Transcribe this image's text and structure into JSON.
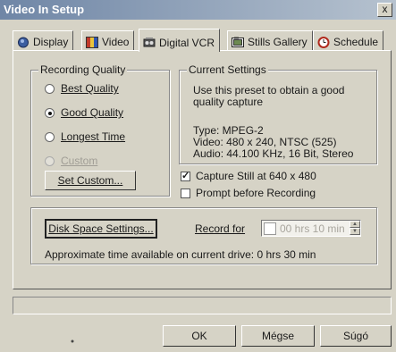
{
  "window": {
    "title": "Video In Setup",
    "close_glyph": "x"
  },
  "tabs": [
    {
      "label": "Display",
      "icon": "display-icon",
      "selected": false
    },
    {
      "label": "Video",
      "icon": "video-icon",
      "selected": false
    },
    {
      "label": "Digital VCR",
      "icon": "digital-vcr-icon",
      "selected": true
    },
    {
      "label": "Stills Gallery",
      "icon": "stills-gallery-icon",
      "selected": false
    },
    {
      "label": "Schedule",
      "icon": "schedule-icon",
      "selected": false
    }
  ],
  "recording_quality": {
    "title": "Recording Quality",
    "options": [
      {
        "label": "Best Quality",
        "selected": false,
        "enabled": true
      },
      {
        "label": "Good Quality",
        "selected": true,
        "enabled": true
      },
      {
        "label": "Longest Time",
        "selected": false,
        "enabled": true
      },
      {
        "label": "Custom",
        "selected": false,
        "enabled": false
      }
    ],
    "set_custom_label": "Set Custom..."
  },
  "current_settings": {
    "title": "Current Settings",
    "description_line1": "Use this preset to obtain a good",
    "description_line2": "quality capture",
    "type_line": "Type:  MPEG-2",
    "video_line": "Video:  480 x 240, NTSC (525)",
    "audio_line": "Audio:  44.100 KHz, 16 Bit, Stereo"
  },
  "options": {
    "capture_still_label": "Capture Still at 640 x 480",
    "capture_still_checked": true,
    "prompt_label": "Prompt before Recording",
    "prompt_checked": false
  },
  "disk": {
    "settings_button": "Disk Space Settings...",
    "record_for_label": "Record for",
    "record_for_value": "00 hrs 10 min",
    "record_for_enabled": false,
    "approx_time": "Approximate time available on current drive: 0 hrs 30 min"
  },
  "footer": {
    "ok": "OK",
    "cancel": "Mégse",
    "help": "Súgó"
  },
  "colors": {
    "titlebar_start": "#6f86a6",
    "titlebar_end": "#b6c2cf",
    "face": "#d6d3c6"
  }
}
